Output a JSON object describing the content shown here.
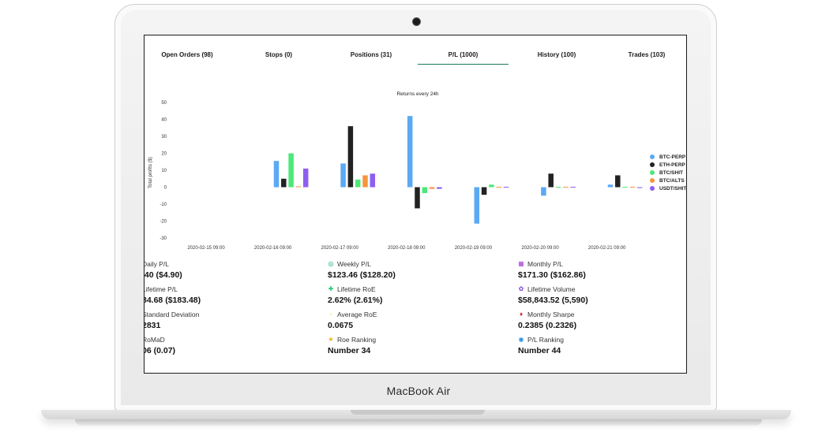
{
  "device": {
    "brand_label": "MacBook Air"
  },
  "tabs": [
    {
      "label": "Open Orders (98)"
    },
    {
      "label": "Stops (0)"
    },
    {
      "label": "Positions (31)"
    },
    {
      "label": "P/L (1000)",
      "active": true
    },
    {
      "label": "History (100)"
    },
    {
      "label": "Trades (103)"
    }
  ],
  "chart_data": {
    "type": "bar",
    "title": "Returns every 24h",
    "ylabel": "Total profits ($)",
    "xlabel": "",
    "ylim": [
      -30,
      50
    ],
    "yticks": [
      50,
      40,
      30,
      20,
      10,
      0,
      -10,
      -20,
      -30
    ],
    "categories": [
      "2020-02-15 09:00",
      "2020-02-16 09:00",
      "2020-02-17 09:00",
      "2020-02-18 09:00",
      "2020-02-19 09:00",
      "2020-02-20 09:00",
      "2020-02-21 09:00"
    ],
    "series": [
      {
        "name": "BTC-PERP",
        "color": "#5aa9f5",
        "values": [
          0,
          15.5,
          14,
          42,
          -21.5,
          -5,
          1.5
        ]
      },
      {
        "name": "ETH-PERP",
        "color": "#222222",
        "values": [
          0,
          5,
          36,
          -12.5,
          -4.5,
          8,
          7
        ]
      },
      {
        "name": "BTC/SHIT",
        "color": "#4ce87a",
        "values": [
          0,
          20,
          4.5,
          -3.5,
          1.5,
          0.3,
          0
        ]
      },
      {
        "name": "BTC/ALTS",
        "color": "#f5963d",
        "values": [
          0,
          0.5,
          7,
          -1,
          0,
          0,
          0
        ]
      },
      {
        "name": "USDT/SHIT",
        "color": "#8e5ef2",
        "values": [
          0,
          11,
          8,
          -1,
          0,
          -0.3,
          -0.5
        ]
      }
    ],
    "legend_position": "right",
    "grid": false
  },
  "stats": [
    {
      "icon": "",
      "label": "Daily P/L",
      "value": ".40 ($4.90)"
    },
    {
      "icon": "◎",
      "icon_name": "target-icon",
      "color": "#19a374",
      "label": "Weekly P/L",
      "value": "$123.46 ($128.20)"
    },
    {
      "icon": "▦",
      "icon_name": "calendar-icon",
      "color": "#a23cd8",
      "label": "Monthly P/L",
      "value": "$171.30 ($162.86)"
    },
    {
      "icon": "",
      "label": "Lifetime P/L",
      "value": "84.68 ($183.48)"
    },
    {
      "icon": "✚",
      "icon_name": "plus-icon",
      "color": "#2cc36b",
      "label": "Lifetime RoE",
      "value": "2.62% (2.61%)"
    },
    {
      "icon": "✿",
      "icon_name": "gear-flower-icon",
      "color": "#7a3cd8",
      "label": "Lifetime Volume",
      "value": "$58,843.52 (5,590)"
    },
    {
      "icon": "",
      "label": "Standard Deviation",
      "value": "2831"
    },
    {
      "icon": "▫",
      "icon_name": "square-icon",
      "color": "#f2d13a",
      "label": "Average RoE",
      "value": "0.0675"
    },
    {
      "icon": "♦",
      "icon_name": "maple-leaf-icon",
      "color": "#d62b2b",
      "label": "Monthly Sharpe",
      "value": "0.2385 (0.2326)"
    },
    {
      "icon": "",
      "label": "RoMaD",
      "value": "06 (0.07)"
    },
    {
      "icon": "★",
      "icon_name": "star-icon",
      "color": "#e8b10f",
      "label": "Roe Ranking",
      "value": "Number 34"
    },
    {
      "icon": "◉",
      "icon_name": "ring-icon",
      "color": "#1f8fe0",
      "label": "P/L Ranking",
      "value": "Number 44"
    }
  ]
}
